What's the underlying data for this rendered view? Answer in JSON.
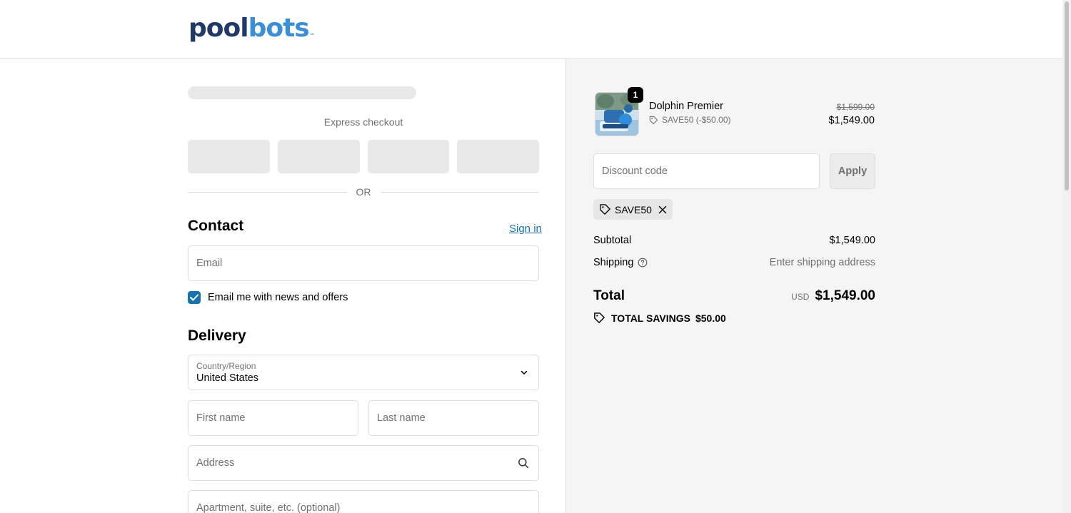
{
  "header": {
    "logo_pool": "pool",
    "logo_bots": "bots",
    "logo_tm": "™"
  },
  "express": {
    "label": "Express checkout",
    "or": "OR"
  },
  "contact": {
    "title": "Contact",
    "signin": "Sign in",
    "email_placeholder": "Email",
    "newsletter_label": "Email me with news and offers",
    "newsletter_checked": true
  },
  "delivery": {
    "title": "Delivery",
    "country_label": "Country/Region",
    "country_value": "United States",
    "first_name_placeholder": "First name",
    "last_name_placeholder": "Last name",
    "address_placeholder": "Address",
    "apartment_placeholder": "Apartment, suite, etc. (optional)"
  },
  "order": {
    "quantity": "1",
    "product_name": "Dolphin Premier",
    "product_discount": "SAVE50 (-$50.00)",
    "old_price": "$1,599.00",
    "new_price": "$1,549.00",
    "discount_placeholder": "Discount code",
    "apply_label": "Apply",
    "applied_code": "SAVE50",
    "subtotal_label": "Subtotal",
    "subtotal_value": "$1,549.00",
    "shipping_label": "Shipping",
    "shipping_value": "Enter shipping address",
    "total_label": "Total",
    "currency": "USD",
    "total_value": "$1,549.00",
    "savings_label": "TOTAL SAVINGS",
    "savings_value": "$50.00"
  },
  "colors": {
    "accent": "#1773b0",
    "logo_dark": "#1f3a68",
    "logo_light": "#3b8fd6",
    "summary_bg": "#f5f5f5"
  }
}
